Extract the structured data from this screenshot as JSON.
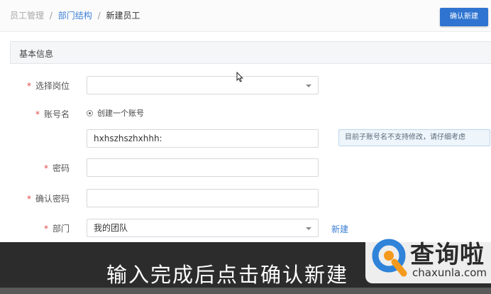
{
  "breadcrumb": {
    "items": [
      "员工管理",
      "部门结构",
      "新建员工"
    ],
    "separator": "/"
  },
  "header": {
    "confirm_label": "确认新建"
  },
  "section": {
    "title": "基本信息"
  },
  "form": {
    "position_label": "选择岗位",
    "position_value": "",
    "account_label": "账号名",
    "account_option": "创建一个账号",
    "account_value": "hxhszhszhxhhh:",
    "account_tip": "目前子账号名不支持修改，请仔细考虑",
    "password_label": "密码",
    "password_value": "",
    "confirm_password_label": "确认密码",
    "confirm_password_value": "",
    "department_label": "部门",
    "department_value": "我的团队",
    "department_new_link": "新建",
    "required_mark": "*"
  },
  "caption": {
    "text": "输入完成后点击确认新建"
  },
  "watermark": {
    "title": "查询啦",
    "subtitle": "chaxunla.com"
  },
  "colors": {
    "accent": "#2f74d0",
    "link": "#3b7fd6",
    "required": "#e04848",
    "caption_bg": "#2c2c2c"
  },
  "icons": {
    "cursor": "mouse-pointer-icon",
    "dropdown": "chevron-down-icon",
    "radio": "radio-selected-icon",
    "logo": "search-q-logo-icon"
  }
}
